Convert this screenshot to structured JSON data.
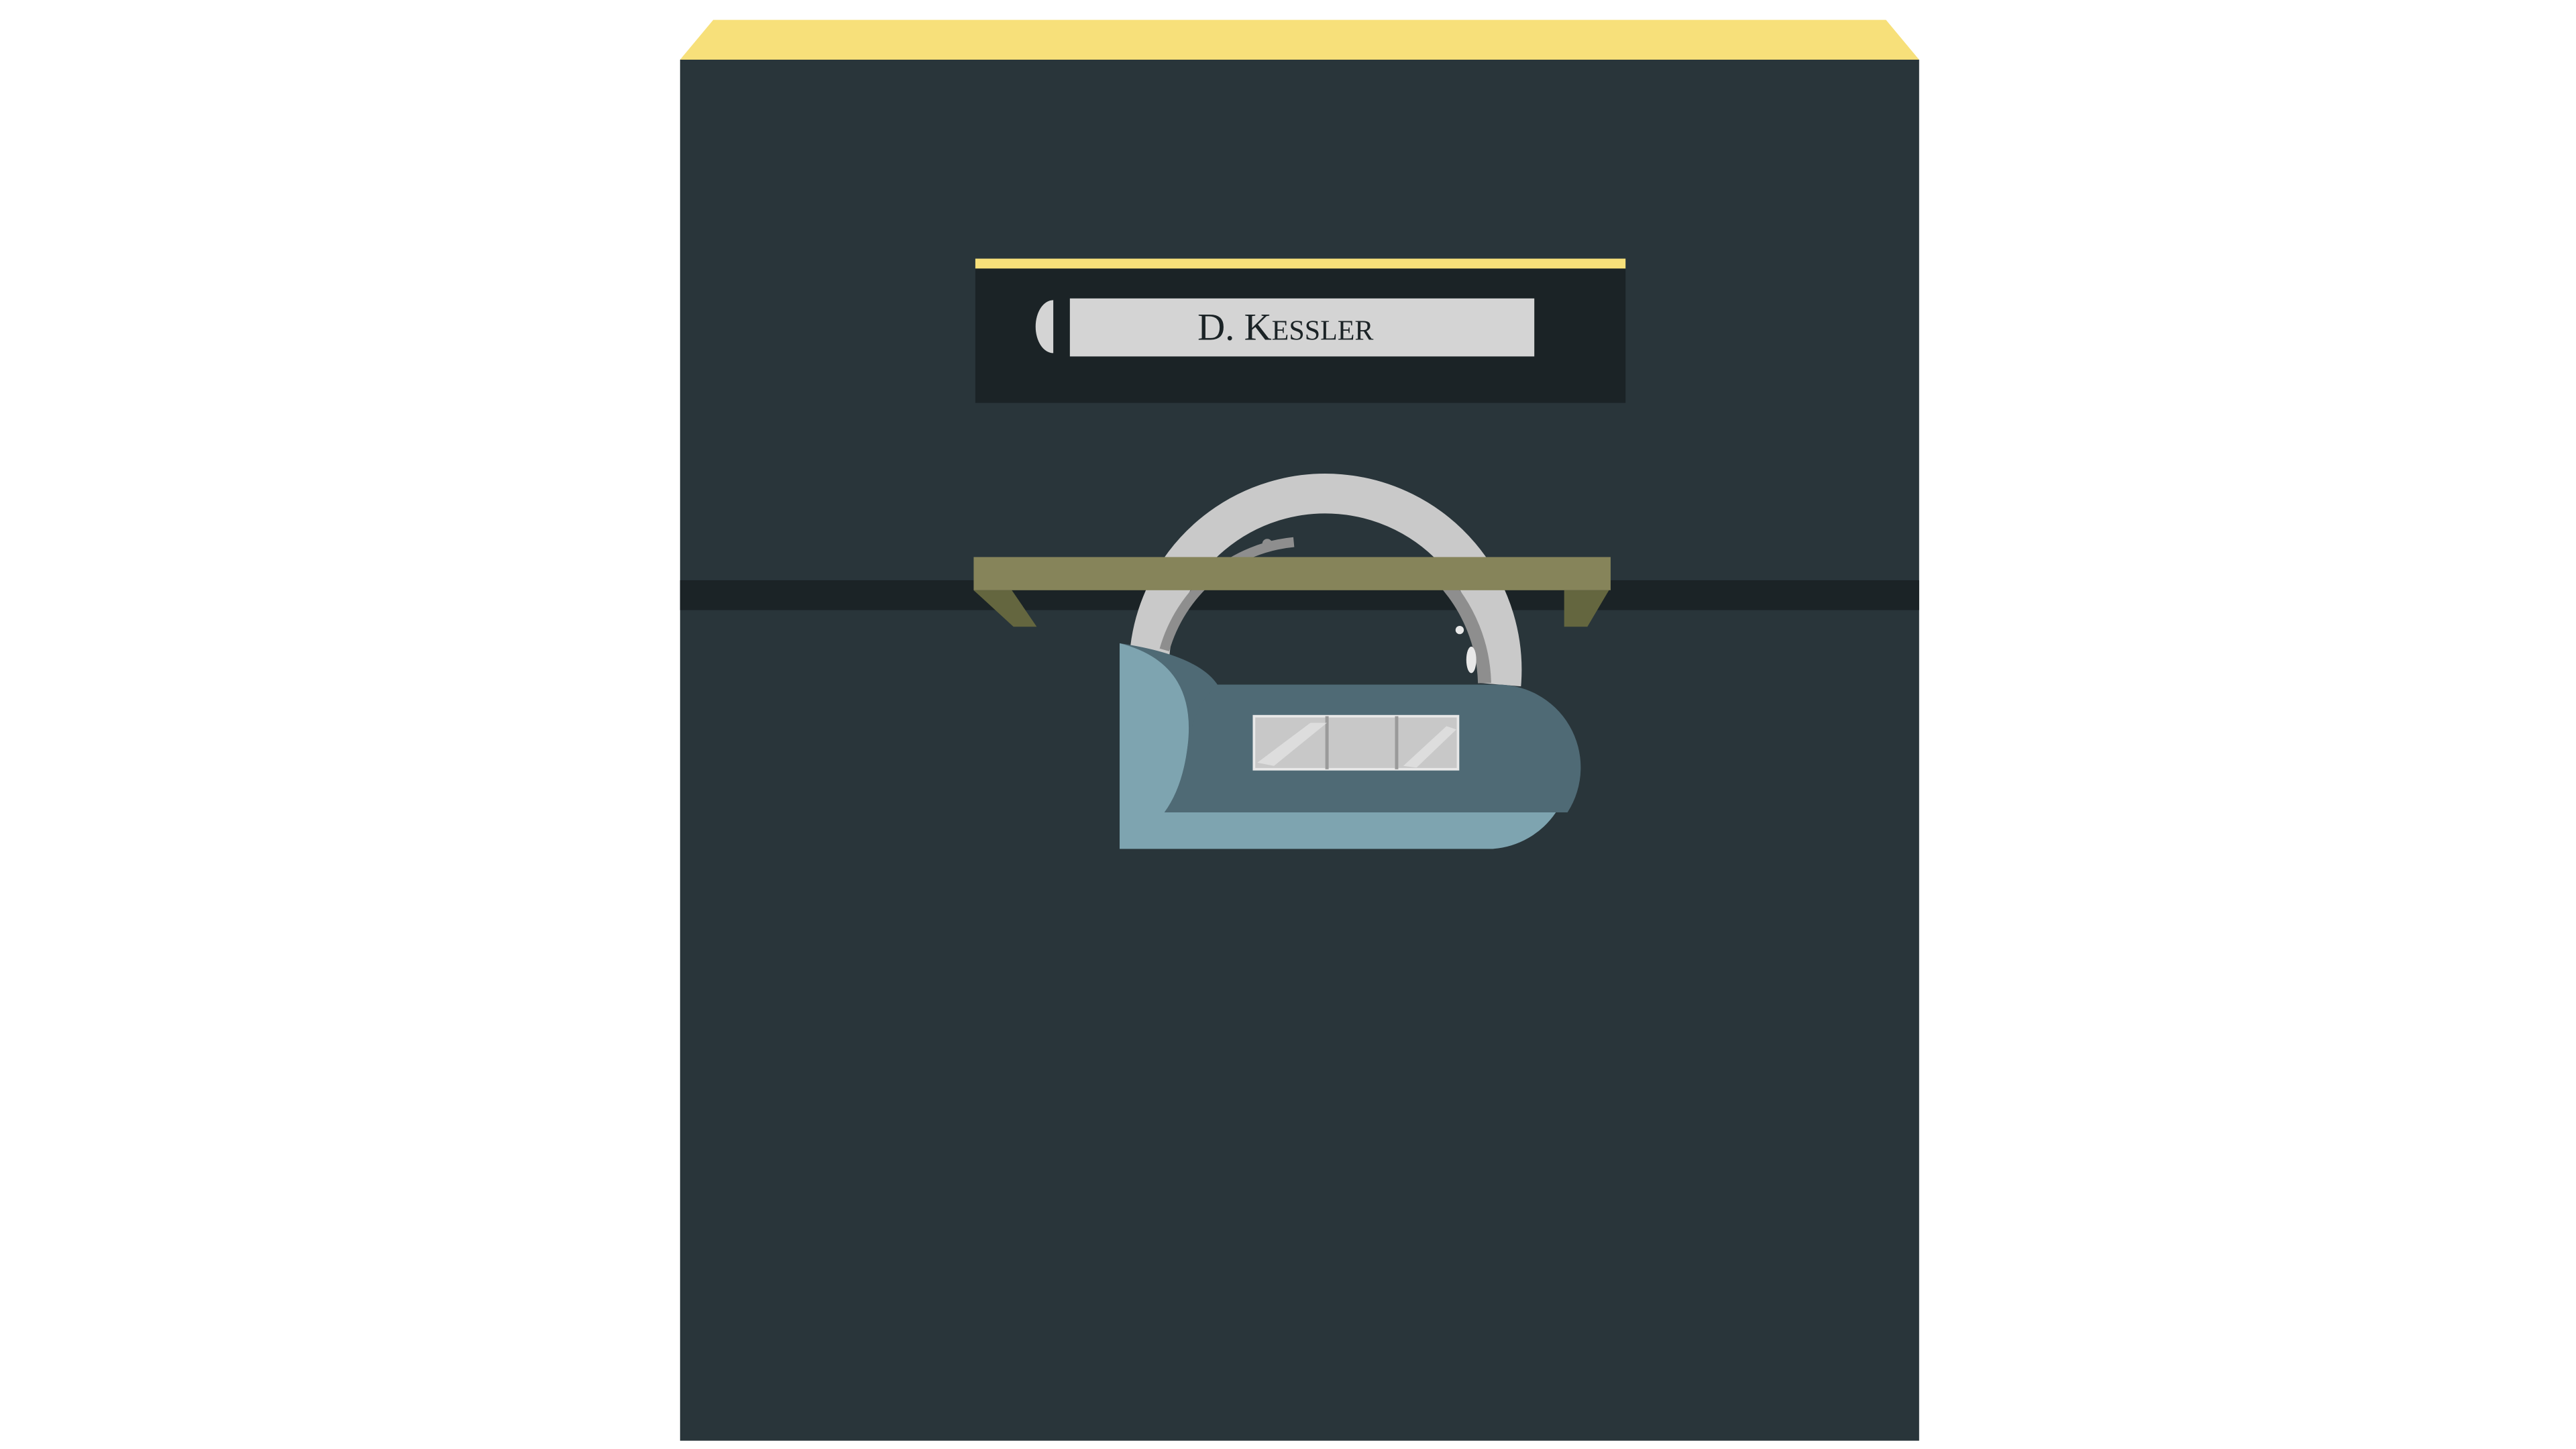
{
  "locker": {
    "name_first": "D. K",
    "name_rest": "ESSLER"
  },
  "colors": {
    "background": "#ffffff",
    "locker_body": "#29353a",
    "locker_top_trim": "#f7e07a",
    "nameplate_frame": "#1b2326",
    "nameplate_accent": "#f7e07a",
    "nameplate_card": "#d4d4d4",
    "nameplate_text": "#1b2326",
    "seam": "#1b2326",
    "hasp_plate": "#86845a",
    "hasp_plate_shadow": "#64663f",
    "shackle": "#c9c9c9",
    "shackle_shadow": "#8e8e8e",
    "lock_body": "#4f6a75",
    "lock_highlight": "#7ea4b0",
    "dial_window": "#c8c8c8"
  },
  "icons": {
    "lock": "padlock-icon"
  }
}
